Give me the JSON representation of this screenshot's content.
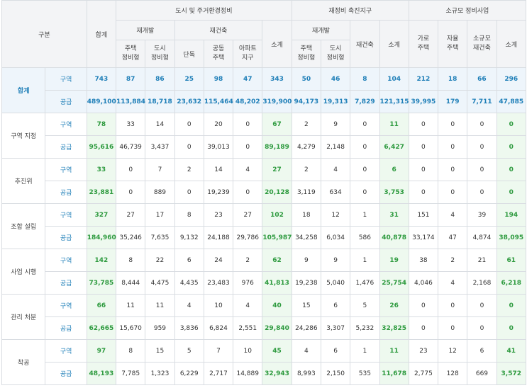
{
  "header": {
    "gubun": "구분",
    "total": "합계",
    "group_city": "도시 및 주거환경정비",
    "group_promo": "재정비 촉진지구",
    "group_small": "소규모 정비사업",
    "redev": "재개발",
    "rebuild": "재건축",
    "subtotal": "소계",
    "redev_housing": [
      "주택",
      "정비형"
    ],
    "redev_urban": [
      "도시",
      "정비형"
    ],
    "rebuild_single": "단독",
    "rebuild_apt_common": [
      "공동",
      "주택"
    ],
    "rebuild_apt_district": [
      "아파트",
      "지구"
    ],
    "promo_housing": [
      "주택",
      "정비형"
    ],
    "promo_urban": [
      "도시",
      "정비형"
    ],
    "promo_rebuild": "재건축",
    "small_street": [
      "가로",
      "주택"
    ],
    "small_auto": [
      "자율",
      "주택"
    ],
    "small_rebuild": [
      "소규모",
      "재건축"
    ]
  },
  "sub_labels": {
    "area": "구역",
    "supply": "공급"
  },
  "groups": [
    {
      "label": "합계",
      "area": [
        "743",
        "87",
        "86",
        "25",
        "98",
        "47",
        "343",
        "50",
        "46",
        "8",
        "104",
        "212",
        "18",
        "66",
        "296"
      ],
      "supply": [
        "489,100",
        "113,884",
        "18,718",
        "23,632",
        "115,464",
        "48,202",
        "319,900",
        "94,173",
        "19,313",
        "7,829",
        "121,315",
        "39,995",
        "179",
        "7,711",
        "47,885"
      ]
    },
    {
      "label": "구역 지정",
      "area": [
        "78",
        "33",
        "14",
        "0",
        "20",
        "0",
        "67",
        "2",
        "9",
        "0",
        "11",
        "0",
        "0",
        "0",
        "0"
      ],
      "supply": [
        "95,616",
        "46,739",
        "3,437",
        "0",
        "39,013",
        "0",
        "89,189",
        "4,279",
        "2,148",
        "0",
        "6,427",
        "0",
        "0",
        "0",
        "0"
      ]
    },
    {
      "label": "추진위",
      "area": [
        "33",
        "0",
        "7",
        "2",
        "14",
        "4",
        "27",
        "2",
        "4",
        "0",
        "6",
        "0",
        "0",
        "0",
        "0"
      ],
      "supply": [
        "23,881",
        "0",
        "889",
        "0",
        "19,239",
        "0",
        "20,128",
        "3,119",
        "634",
        "0",
        "3,753",
        "0",
        "0",
        "0",
        "0"
      ]
    },
    {
      "label": "조합 설립",
      "area": [
        "327",
        "27",
        "17",
        "8",
        "23",
        "27",
        "102",
        "18",
        "12",
        "1",
        "31",
        "151",
        "4",
        "39",
        "194"
      ],
      "supply": [
        "184,960",
        "35,246",
        "7,635",
        "9,132",
        "24,188",
        "29,786",
        "105,987",
        "34,258",
        "6,034",
        "586",
        "40,878",
        "33,174",
        "47",
        "4,874",
        "38,095"
      ]
    },
    {
      "label": "사업 시행",
      "area": [
        "142",
        "8",
        "22",
        "6",
        "24",
        "2",
        "62",
        "9",
        "9",
        "1",
        "19",
        "38",
        "2",
        "21",
        "61"
      ],
      "supply": [
        "73,785",
        "8,444",
        "4,475",
        "4,435",
        "23,483",
        "976",
        "41,813",
        "19,238",
        "5,040",
        "1,476",
        "25,754",
        "4,046",
        "4",
        "2,168",
        "6,218"
      ]
    },
    {
      "label": "관리 처분",
      "area": [
        "66",
        "11",
        "11",
        "4",
        "10",
        "4",
        "40",
        "15",
        "6",
        "5",
        "26",
        "0",
        "0",
        "0",
        "0"
      ],
      "supply": [
        "62,665",
        "15,670",
        "959",
        "3,836",
        "6,824",
        "2,551",
        "29,840",
        "24,286",
        "3,307",
        "5,232",
        "32,825",
        "0",
        "0",
        "0",
        "0"
      ]
    },
    {
      "label": "착공",
      "area": [
        "97",
        "8",
        "15",
        "5",
        "7",
        "10",
        "45",
        "4",
        "6",
        "1",
        "11",
        "23",
        "12",
        "6",
        "41"
      ],
      "supply": [
        "48,193",
        "7,785",
        "1,323",
        "6,229",
        "2,717",
        "14,889",
        "32,943",
        "8,993",
        "2,150",
        "535",
        "11,678",
        "2,775",
        "128",
        "669",
        "3,572"
      ]
    }
  ]
}
